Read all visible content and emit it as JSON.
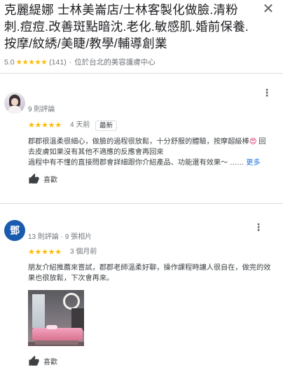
{
  "header": {
    "title": "克麗緹娜 士林美崙店/士林客製化做臉.清粉刺.痘痘.改善斑點暗沈.老化.敏感肌.婚前保養.按摩/紋綉/美睫/教學/輔導創業",
    "close_icon": "close-icon",
    "rating": "5.0",
    "stars": "★★★★★",
    "review_count": "(141)",
    "separator": "·",
    "location": "位於台北的美容護膚中心"
  },
  "reviews": [
    {
      "avatar_icon": "avatar-photo",
      "meta": "9 則評論",
      "stars": "★★★★★",
      "when": "4 天前",
      "badge": "最新",
      "text_line1": "郡郡很溫柔很細心，做臉的過程很放鬆，十分舒服的體驗，按摩超級棒",
      "emoji": "😍",
      "text_line1_tail": " 回",
      "text_line2": "去皮膚如果沒有其他不適應的反應會再回來",
      "text_line3": "過程中有不懂的直接問郡會詳細跟你介紹產品、功能還有效果～ ……",
      "more_label": "更多",
      "like_label": "喜歡"
    },
    {
      "avatar_letter": "鄧",
      "meta": "13 則評論 · 9 張相片",
      "stars": "★★★★★",
      "when": "3 個月前",
      "text_line1": "朋友介紹推薦來嘗試，郡郡老師溫柔好聊，操作課程時讓人很自在，做完的效",
      "text_line2": "果也很放鬆，下次會再來。",
      "like_label": "喜歡"
    }
  ],
  "colors": {
    "star": "#fbbc04",
    "link": "#1a73e8",
    "avatar_letter_bg": "#1a5bb0",
    "divider": "#dadce0"
  }
}
